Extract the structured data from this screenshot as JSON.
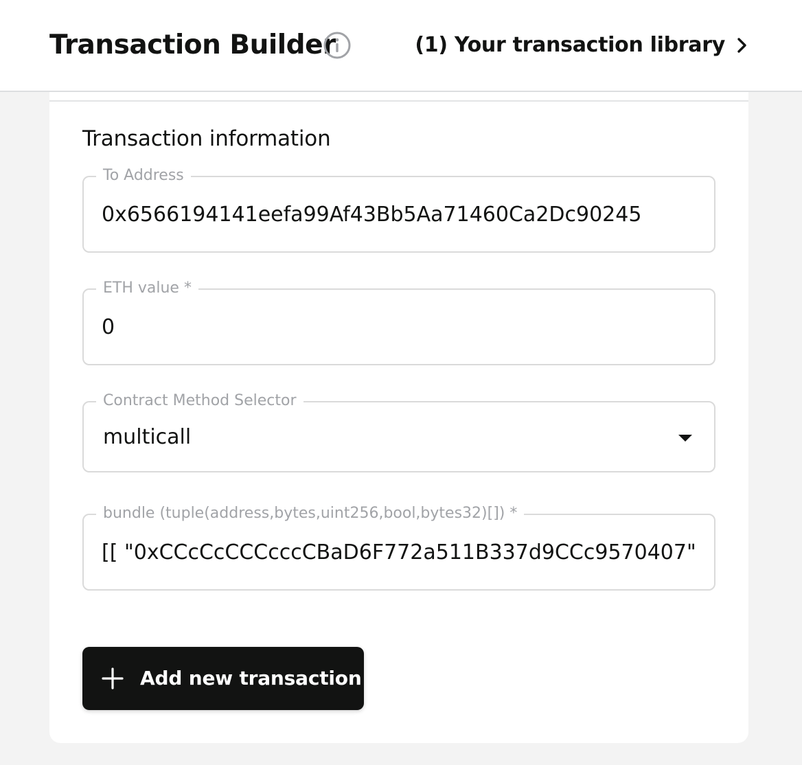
{
  "header": {
    "title": "Transaction Builder",
    "info_icon": "info-icon",
    "library_link_label": "(1) Your transaction library",
    "library_chevron_icon": "chevron-right-icon"
  },
  "form": {
    "section_title": "Transaction information",
    "to_address": {
      "label": "To Address",
      "value": "0x6566194141eefa99Af43Bb5Aa71460Ca2Dc90245"
    },
    "eth_value": {
      "label": "ETH value *",
      "value": "0"
    },
    "method_selector": {
      "label": "Contract Method Selector",
      "selected": "multicall",
      "icon": "caret-down-icon"
    },
    "bundle": {
      "label": "bundle (tuple(address,bytes,uint256,bool,bytes32)[]) *",
      "value": "[[ \"0xCCcCcCCCcccCBaD6F772a511B337d9CCc9570407\","
    }
  },
  "actions": {
    "add_transaction_label": "Add new transaction",
    "add_icon": "plus-icon"
  },
  "colors": {
    "page_background": "#f3f3f3",
    "card_background": "#ffffff",
    "primary_text": "#121312",
    "label_text": "#a1a3a7",
    "field_border": "#dadada",
    "button_background": "#121312",
    "button_text": "#ffffff"
  }
}
